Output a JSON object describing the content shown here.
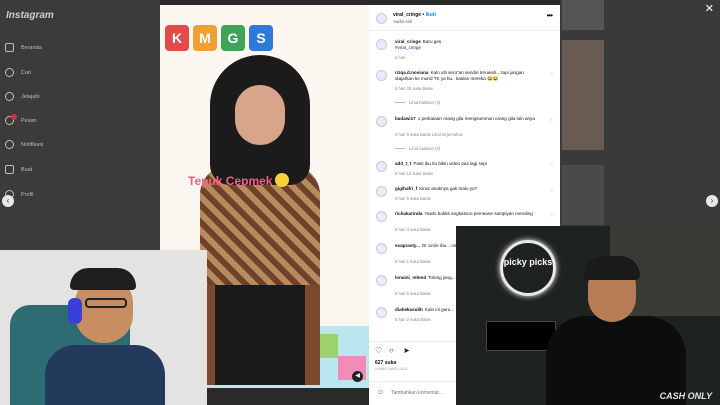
{
  "app": {
    "logo": "Instagram",
    "close_glyph": "✕"
  },
  "sidebar": {
    "items": [
      {
        "label": "Beranda",
        "icon": "home-icon"
      },
      {
        "label": "Cari",
        "icon": "search-icon"
      },
      {
        "label": "Jelajahi",
        "icon": "compass-icon"
      },
      {
        "label": "Pesan",
        "icon": "messenger-icon"
      },
      {
        "label": "Notifikasi",
        "icon": "heart-icon"
      },
      {
        "label": "Buat",
        "icon": "plus-icon"
      },
      {
        "label": "Profil",
        "icon": "profile-icon"
      }
    ]
  },
  "media": {
    "overlay_text": "Tepuk Cepmek",
    "wall_letters": [
      "K",
      "M",
      "G",
      "S"
    ],
    "mute_glyph": "◀"
  },
  "post": {
    "header": {
      "username": "viral_cringe",
      "follow": "Ikuti",
      "audio": "Audio Asli",
      "more": "•••"
    },
    "caption": {
      "username": "viral_cringe",
      "text": "Baru ges",
      "hashtag": "#viral_cringe",
      "time": "5 hari"
    },
    "comments": [
      {
        "username": "rizqa.d.noviana",
        "text": "Kalo ulti seru\"an sendiri teruwah... tapi jangan diajarkan ke murid TK ya bu.. kasian mereka 😂😂",
        "meta": "5 hari   25 suka   Balas",
        "replies": "Lihat balasan (3)"
      },
      {
        "username": "badawi17",
        "text": "1 perkataan orang gila mengsummon orang gila lain anya",
        "meta": "5 hari   8 suka   Balas   Lihat terjemahan",
        "replies": "Lihat balasan (3)"
      },
      {
        "username": "adit_t_t",
        "text": "Pasti ibu itu bikin video pas lagi sepi",
        "meta": "5 hari   13 suka   Balas",
        "replies": ""
      },
      {
        "username": "gigihafri_f",
        "text": "Kira2 anaknya gak malu ya?",
        "meta": "5 hari   5 suka   Balas",
        "replies": ""
      },
      {
        "username": "richakarinda",
        "text": "Yawlo bukkk angkatono pemeane sampiyan mending",
        "meta": "5 hari   4 suka   Balas",
        "replies": ""
      },
      {
        "username": "exaprasty...",
        "text": "Dr circle ibu... omongan ama itu2 kan nya...",
        "meta": "5 hari   1 suka   Balas",
        "replies": ""
      },
      {
        "username": "lonaini_mhmd",
        "text": "Tolong jang... Takutnya mereka nanti pad...",
        "meta": "5 hari   5 suka   Balas",
        "replies": ""
      },
      {
        "username": "diahekasulih",
        "text": "Kalo ini guru...",
        "meta": "5 hari   2 suka   Balas",
        "replies": ""
      }
    ],
    "likes": "627 suka",
    "date": "5 HARI YANG LALU",
    "add_comment_placeholder": "Tambahkan komentar..."
  },
  "webcam_right": {
    "neon_sign": "picky picks",
    "watermark": "CASH ONLY"
  },
  "nav_arrows": {
    "left": "‹",
    "right": "›"
  }
}
